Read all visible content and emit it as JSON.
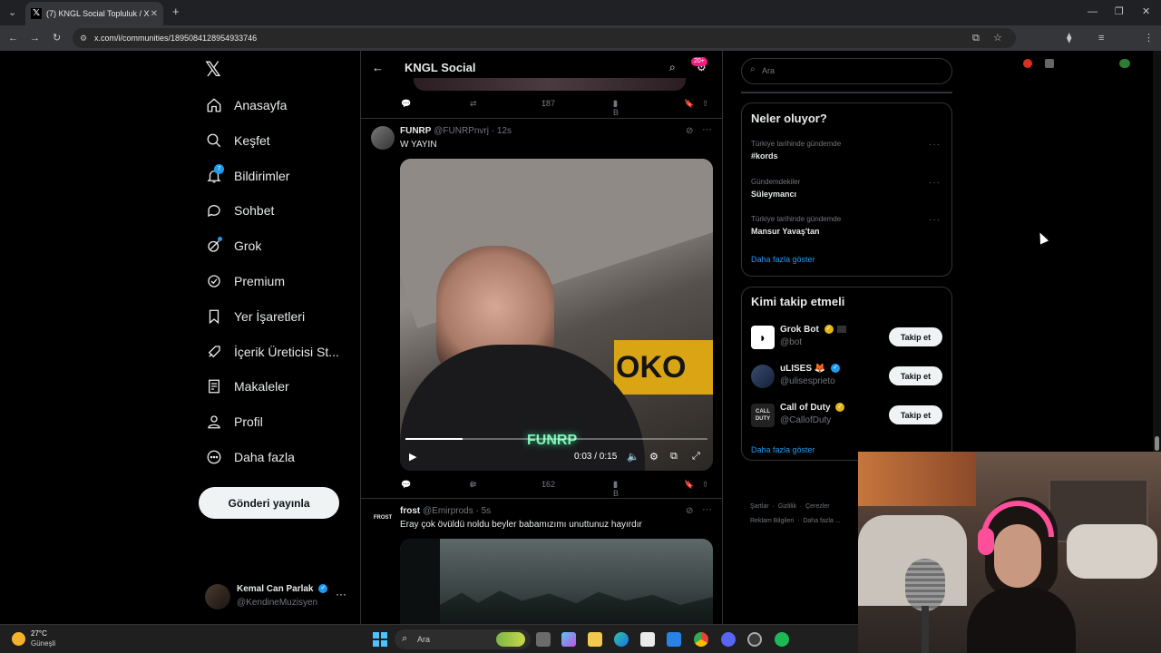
{
  "browser": {
    "tab_title": "(7) KNGL Social Topluluk / X",
    "url": "x.com/i/communities/1895084128954933746"
  },
  "nav": {
    "items": [
      {
        "label": "Anasayfa",
        "icon": "home-icon"
      },
      {
        "label": "Keşfet",
        "icon": "search-icon"
      },
      {
        "label": "Bildirimler",
        "icon": "bell-icon",
        "badge": "7"
      },
      {
        "label": "Sohbet",
        "icon": "chat-icon"
      },
      {
        "label": "Grok",
        "icon": "grok-icon"
      },
      {
        "label": "Premium",
        "icon": "premium-icon"
      },
      {
        "label": "Yer İşaretleri",
        "icon": "bookmark-icon"
      },
      {
        "label": "İçerik Üreticisi St...",
        "icon": "rocket-icon"
      },
      {
        "label": "Makaleler",
        "icon": "article-icon"
      },
      {
        "label": "Profil",
        "icon": "profile-icon"
      },
      {
        "label": "Daha fazla",
        "icon": "more-circle-icon"
      }
    ],
    "post_button": "Gönderi yayınla",
    "account": {
      "name": "Kemal Can Parlak",
      "handle": "@KendineMuzisyen"
    }
  },
  "feed": {
    "title": "KNGL Social",
    "badge": "20+",
    "prev_post_actions": {
      "likes": "187",
      "views": "3 B"
    },
    "post1": {
      "name": "FUNRP",
      "handle": "@FUNRPnvrj",
      "time": "· 12s",
      "text": "W YAYIN",
      "video_time": "0:03 / 0:15",
      "video_watermark": "FUNRP",
      "video_sign": "OKO",
      "video_progress": 0.19,
      "actions": {
        "reposts": "6",
        "likes": "162",
        "views": "3 B"
      }
    },
    "post2": {
      "name": "frost",
      "handle": "@Emirprods",
      "time": "· 5s",
      "text": "Eray çok övüldü noldu beyler babamızımı unuttunuz hayırdır",
      "avatar_text": "FROST"
    }
  },
  "right": {
    "search_placeholder": "Ara",
    "trends_title": "Neler oluyor?",
    "trends": [
      {
        "sub": "Türkiye tarihinde gündemde",
        "name": "#kords"
      },
      {
        "sub": "Gündemdekiler",
        "name": "Süleymancı"
      },
      {
        "sub": "Türkiye tarihinde gündemde",
        "name": "Mansur Yavaş'tan"
      }
    ],
    "trends_more": "Daha fazla göster",
    "who_title": "Kimi takip etmeli",
    "who": [
      {
        "name": "Grok Bot",
        "handle": "@bot",
        "button": "Takip et"
      },
      {
        "name": "uLISES 🦊",
        "handle": "@ulisesprieto",
        "button": "Takip et"
      },
      {
        "name": "Call of Duty",
        "handle": "@CallofDuty",
        "button": "Takip et",
        "avatar_text": "CALL DUTY"
      }
    ],
    "who_more": "Daha fazla göster",
    "footer1": [
      "Şartlar",
      "Gizlilik",
      "Çerezler"
    ],
    "footer2": [
      "Reklam Bilgileri",
      "Daha fazla ..."
    ]
  },
  "taskbar": {
    "weather_temp": "27°C",
    "weather_desc": "Güneşli",
    "search_placeholder": "Ara"
  },
  "colors": {
    "accent": "#1d9bf0",
    "pink": "#f91880",
    "gold": "#e2b719"
  }
}
